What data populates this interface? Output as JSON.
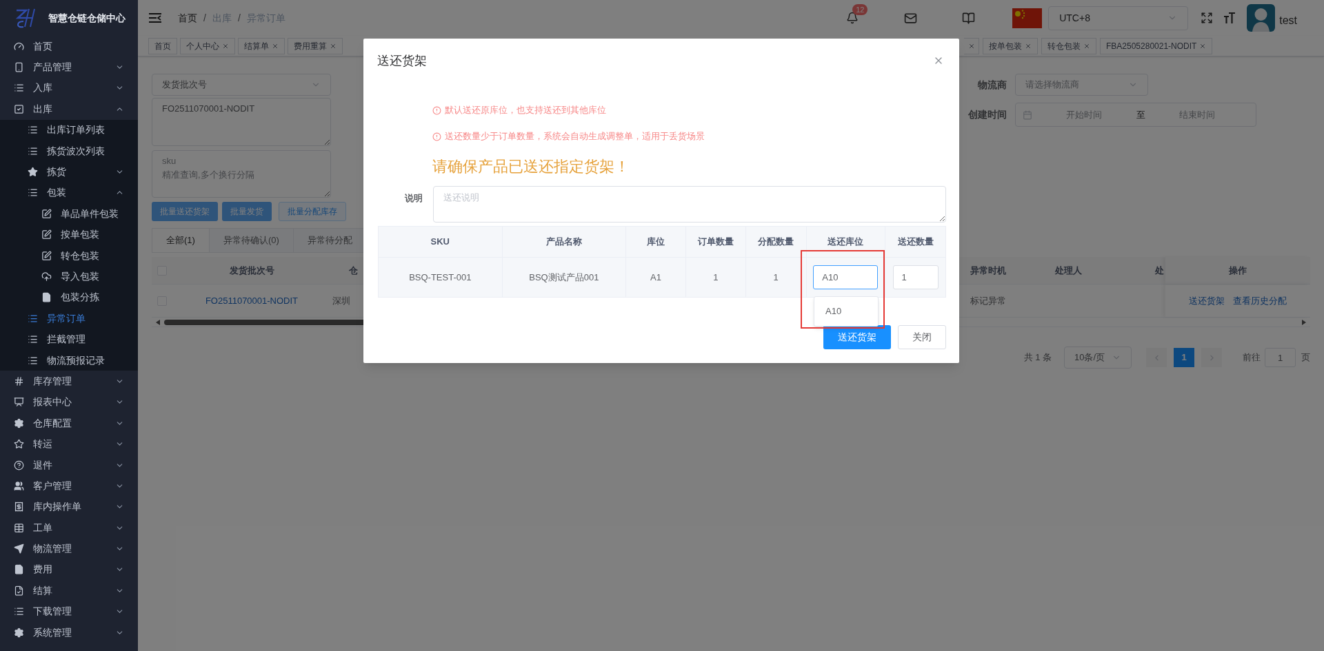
{
  "sidebar": {
    "title": "智慧仓链仓储中心",
    "items": [
      {
        "label": "首页",
        "selected": false
      },
      {
        "label": "产品管理",
        "selected": false,
        "expanded": false
      },
      {
        "label": "入库",
        "selected": false,
        "expanded": false
      },
      {
        "label": "出库",
        "selected": false,
        "expanded": true,
        "children": [
          {
            "label": "出库订单列表",
            "selected": false
          },
          {
            "label": "拣货波次列表",
            "selected": false
          },
          {
            "label": "拣货",
            "selected": false,
            "expanded": false
          },
          {
            "label": "包装",
            "selected": false,
            "expanded": true,
            "children": [
              {
                "label": "单品单件包装",
                "selected": false
              },
              {
                "label": "按单包装",
                "selected": false
              },
              {
                "label": "转仓包装",
                "selected": false
              },
              {
                "label": "导入包装",
                "selected": false
              },
              {
                "label": "包装分拣",
                "selected": false
              }
            ]
          },
          {
            "label": "异常订单",
            "selected": true
          },
          {
            "label": "拦截管理",
            "selected": false
          },
          {
            "label": "物流预报记录",
            "selected": false
          }
        ]
      },
      {
        "label": "库存管理",
        "selected": false,
        "expanded": false
      },
      {
        "label": "报表中心",
        "selected": false,
        "expanded": false
      },
      {
        "label": "仓库配置",
        "selected": false,
        "expanded": false
      },
      {
        "label": "转运",
        "selected": false,
        "expanded": false
      },
      {
        "label": "退件",
        "selected": false,
        "expanded": false
      },
      {
        "label": "客户管理",
        "selected": false,
        "expanded": false
      },
      {
        "label": "库内操作单",
        "selected": false,
        "expanded": false
      },
      {
        "label": "工单",
        "selected": false,
        "expanded": false
      },
      {
        "label": "物流管理",
        "selected": false,
        "expanded": false
      },
      {
        "label": "费用",
        "selected": false,
        "expanded": false
      },
      {
        "label": "结算",
        "selected": false,
        "expanded": false
      },
      {
        "label": "下载管理",
        "selected": false,
        "expanded": false
      },
      {
        "label": "系统管理",
        "selected": false,
        "expanded": false
      }
    ]
  },
  "header": {
    "breadcrumb": [
      "首页",
      "出库",
      "异常订单"
    ],
    "breadcrumb_separator": "/",
    "notification_count": "12",
    "timezone": "UTC+8",
    "user": "test"
  },
  "tabs": {
    "left": [
      {
        "label": "首页",
        "closable": false,
        "selected": false
      },
      {
        "label": "个人中心",
        "closable": true,
        "selected": false
      },
      {
        "label": "结算单",
        "closable": true,
        "selected": false
      },
      {
        "label": "费用重算",
        "closable": true,
        "selected": false
      }
    ],
    "partial_tab_close": true,
    "right": [
      {
        "label": "按单包装",
        "closable": true,
        "selected": false
      },
      {
        "label": "转仓包装",
        "closable": true,
        "selected": false
      },
      {
        "label": "FBA2505280021-NODIT",
        "closable": true,
        "selected": false
      }
    ]
  },
  "filters": {
    "batch_type": "发货批次号",
    "batch_value": "FO2511070001-NODIT",
    "sku_placeholder": "sku\n精准查询,多个换行分隔",
    "logistics": {
      "label": "物流商",
      "placeholder": "请选择物流商"
    },
    "created": {
      "label": "创建时间",
      "start_placeholder": "开始时间",
      "separator": "至",
      "end_placeholder": "结束时间"
    }
  },
  "actions": [
    {
      "label": "批量送还货架",
      "kind": "primary"
    },
    {
      "label": "批量发货",
      "kind": "primary"
    },
    {
      "label": "批量分配库存",
      "kind": "plain"
    }
  ],
  "status_tabs": [
    {
      "label": "全部(1)",
      "selected": true
    },
    {
      "label": "异常待确认(0)",
      "selected": false
    },
    {
      "label": "异常待分配",
      "selected": false
    }
  ],
  "table": {
    "header_checked": false,
    "columns_left": [
      "发货批次号",
      "仓"
    ],
    "columns_right": [
      "异常时机",
      "处理人",
      "处"
    ],
    "action_column": "操作",
    "rows": [
      {
        "checked": false,
        "batch": "FO2511070001-NODIT",
        "column_3": "深圳",
        "timing": "标记异常",
        "actions": [
          "送还货架",
          "查看历史分配"
        ]
      }
    ]
  },
  "pagination": {
    "total": "共 1 条",
    "page_size": "10条/页",
    "pages": [
      {
        "label": "1",
        "selected": true
      }
    ],
    "goto_label": "前往",
    "goto_value": "1",
    "page_suffix": "页"
  },
  "modal": {
    "title": "送还货架",
    "notes": [
      "默认送还原库位，也支持送还到其他库位",
      "送还数量少于订单数量，系统会自动生成调整单，适用于丢货场景"
    ],
    "warning": "请确保产品已送还指定货架！",
    "remark_label": "说明",
    "remark_placeholder": "送还说明",
    "columns": [
      "SKU",
      "产品名称",
      "库位",
      "订单数量",
      "分配数量",
      "送还库位",
      "送还数量"
    ],
    "rows": [
      {
        "sku": "BSQ-TEST-001",
        "name": "BSQ测试产品001",
        "location": "A1",
        "order_qty": "1",
        "alloc_qty": "1",
        "return_location": "A10",
        "return_location_focused": true,
        "return_qty": "1"
      }
    ],
    "suggestions": [
      "A10"
    ],
    "buttons": [
      {
        "label": "送还货架",
        "kind": "primary"
      },
      {
        "label": "关闭",
        "kind": "default"
      }
    ]
  }
}
